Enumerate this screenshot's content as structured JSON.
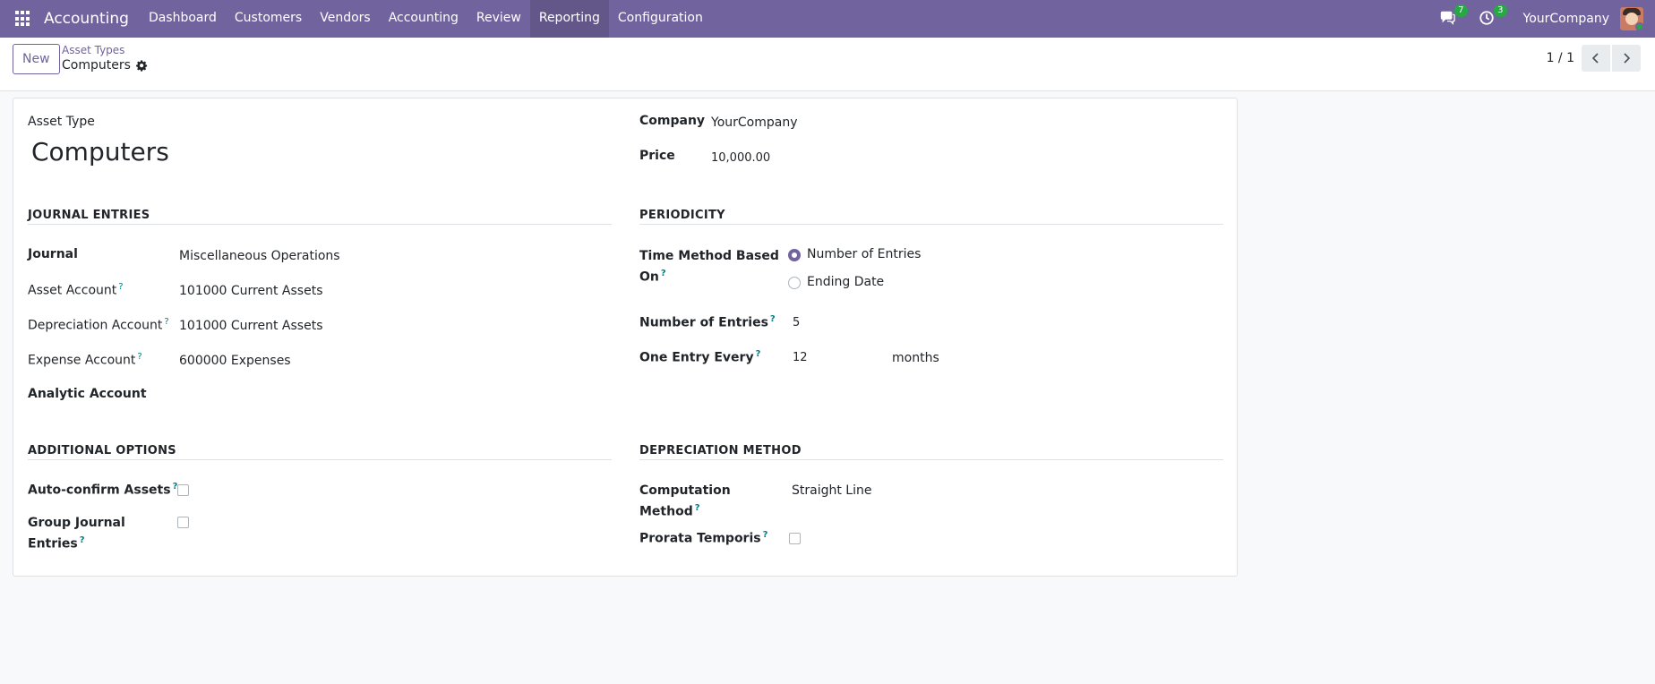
{
  "navbar": {
    "app_name": "Accounting",
    "menu": [
      "Dashboard",
      "Customers",
      "Vendors",
      "Accounting",
      "Review",
      "Reporting",
      "Configuration"
    ],
    "active_menu": "Reporting",
    "messages_count": "7",
    "activities_count": "3",
    "company": "YourCompany"
  },
  "control_panel": {
    "new_label": "New",
    "breadcrumb_parent": "Asset Types",
    "breadcrumb_current": "Computers",
    "pager": "1 / 1"
  },
  "form": {
    "asset_type_label": "Asset Type",
    "asset_type_value": "Computers",
    "company_label": "Company",
    "company_value": "YourCompany",
    "price_label": "Price",
    "price_value": "10,000.00",
    "journal_entries": {
      "title": "JOURNAL ENTRIES",
      "journal_label": "Journal",
      "journal_value": "Miscellaneous Operations",
      "asset_account_label": "Asset Account",
      "asset_account_value": "101000 Current Assets",
      "depreciation_account_label": "Depreciation Account",
      "depreciation_account_value": "101000 Current Assets",
      "expense_account_label": "Expense Account",
      "expense_account_value": "600000 Expenses",
      "analytic_account_label": "Analytic Account"
    },
    "periodicity": {
      "title": "PERIODICITY",
      "time_method_label_1": "Time Method Based",
      "time_method_label_2": "On",
      "option_entries": "Number of Entries",
      "option_ending": "Ending Date",
      "number_entries_label": "Number of Entries",
      "number_entries_value": "5",
      "one_entry_label": "One Entry Every",
      "one_entry_value": "12",
      "one_entry_unit": "months"
    },
    "additional": {
      "title": "ADDITIONAL OPTIONS",
      "auto_confirm_label": "Auto-confirm Assets",
      "group_journal_label_1": "Group Journal",
      "group_journal_label_2": "Entries"
    },
    "depreciation": {
      "title": "DEPRECIATION METHOD",
      "computation_label_1": "Computation",
      "computation_label_2": "Method",
      "computation_value": "Straight Line",
      "prorata_label": "Prorata Temporis"
    },
    "help_mark": "?"
  },
  "colors": {
    "brand": "#71639e",
    "help": "#017e84",
    "badge": "#28a745"
  }
}
